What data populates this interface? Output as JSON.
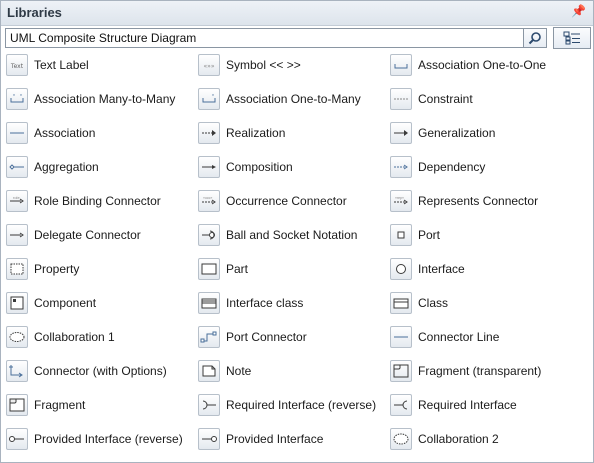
{
  "panel": {
    "title": "Libraries"
  },
  "search": {
    "value": "UML Composite Structure Diagram"
  },
  "items": [
    {
      "label": "Text Label",
      "icon": "text-label-icon"
    },
    {
      "label": "Symbol << >>",
      "icon": "symbol-icon"
    },
    {
      "label": "Association One-to-One",
      "icon": "association-one-to-one-icon"
    },
    {
      "label": "Association Many-to-Many",
      "icon": "association-many-to-many-icon"
    },
    {
      "label": "Association One-to-Many",
      "icon": "association-one-to-many-icon"
    },
    {
      "label": "Constraint",
      "icon": "constraint-icon"
    },
    {
      "label": "Association",
      "icon": "association-icon"
    },
    {
      "label": "Realization",
      "icon": "realization-icon"
    },
    {
      "label": "Generalization",
      "icon": "generalization-icon"
    },
    {
      "label": "Aggregation",
      "icon": "aggregation-icon"
    },
    {
      "label": "Composition",
      "icon": "composition-icon"
    },
    {
      "label": "Dependency",
      "icon": "dependency-icon"
    },
    {
      "label": "Role Binding Connector",
      "icon": "role-binding-connector-icon"
    },
    {
      "label": "Occurrence Connector",
      "icon": "occurrence-connector-icon"
    },
    {
      "label": "Represents Connector",
      "icon": "represents-connector-icon"
    },
    {
      "label": "Delegate Connector",
      "icon": "delegate-connector-icon"
    },
    {
      "label": "Ball and Socket Notation",
      "icon": "ball-and-socket-icon"
    },
    {
      "label": "Port",
      "icon": "port-icon"
    },
    {
      "label": "Property",
      "icon": "property-icon"
    },
    {
      "label": "Part",
      "icon": "part-icon"
    },
    {
      "label": "Interface",
      "icon": "interface-icon"
    },
    {
      "label": "Component",
      "icon": "component-icon"
    },
    {
      "label": "Interface class",
      "icon": "interface-class-icon"
    },
    {
      "label": "Class",
      "icon": "class-icon"
    },
    {
      "label": "Collaboration 1",
      "icon": "collaboration-icon"
    },
    {
      "label": "Port Connector",
      "icon": "port-connector-icon"
    },
    {
      "label": "Connector Line",
      "icon": "connector-line-icon"
    },
    {
      "label": "Connector (with Options)",
      "icon": "connector-with-options-icon"
    },
    {
      "label": "Note",
      "icon": "note-icon"
    },
    {
      "label": "Fragment (transparent)",
      "icon": "fragment-transparent-icon"
    },
    {
      "label": "Fragment",
      "icon": "fragment-icon"
    },
    {
      "label": "Required Interface (reverse)",
      "icon": "required-interface-reverse-icon"
    },
    {
      "label": "Required Interface",
      "icon": "required-interface-icon"
    },
    {
      "label": "Provided Interface (reverse)",
      "icon": "provided-interface-reverse-icon"
    },
    {
      "label": "Provided Interface",
      "icon": "provided-interface-icon"
    },
    {
      "label": "Collaboration 2",
      "icon": "collaboration-2-icon"
    }
  ]
}
